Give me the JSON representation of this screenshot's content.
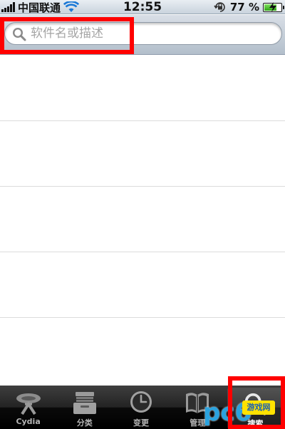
{
  "status_bar": {
    "carrier": "中国联通",
    "time": "12:55",
    "battery_percent": "77 %",
    "battery_level": 0.77
  },
  "search": {
    "placeholder": "软件名或描述",
    "value": ""
  },
  "results": [
    {
      "title": ""
    },
    {
      "title": ""
    },
    {
      "title": ""
    },
    {
      "title": ""
    },
    {
      "title": ""
    }
  ],
  "tabs": [
    {
      "label": "Cydia",
      "icon": "cydia-icon"
    },
    {
      "label": "分类",
      "icon": "sections-icon"
    },
    {
      "label": "变更",
      "icon": "clock-icon"
    },
    {
      "label": "管理",
      "icon": "book-icon"
    },
    {
      "label": "搜索",
      "icon": "search-icon"
    }
  ],
  "active_tab": "搜索",
  "highlight_color": "#ff0000",
  "watermark": {
    "text": "pc6",
    "badge": "游戏网"
  }
}
